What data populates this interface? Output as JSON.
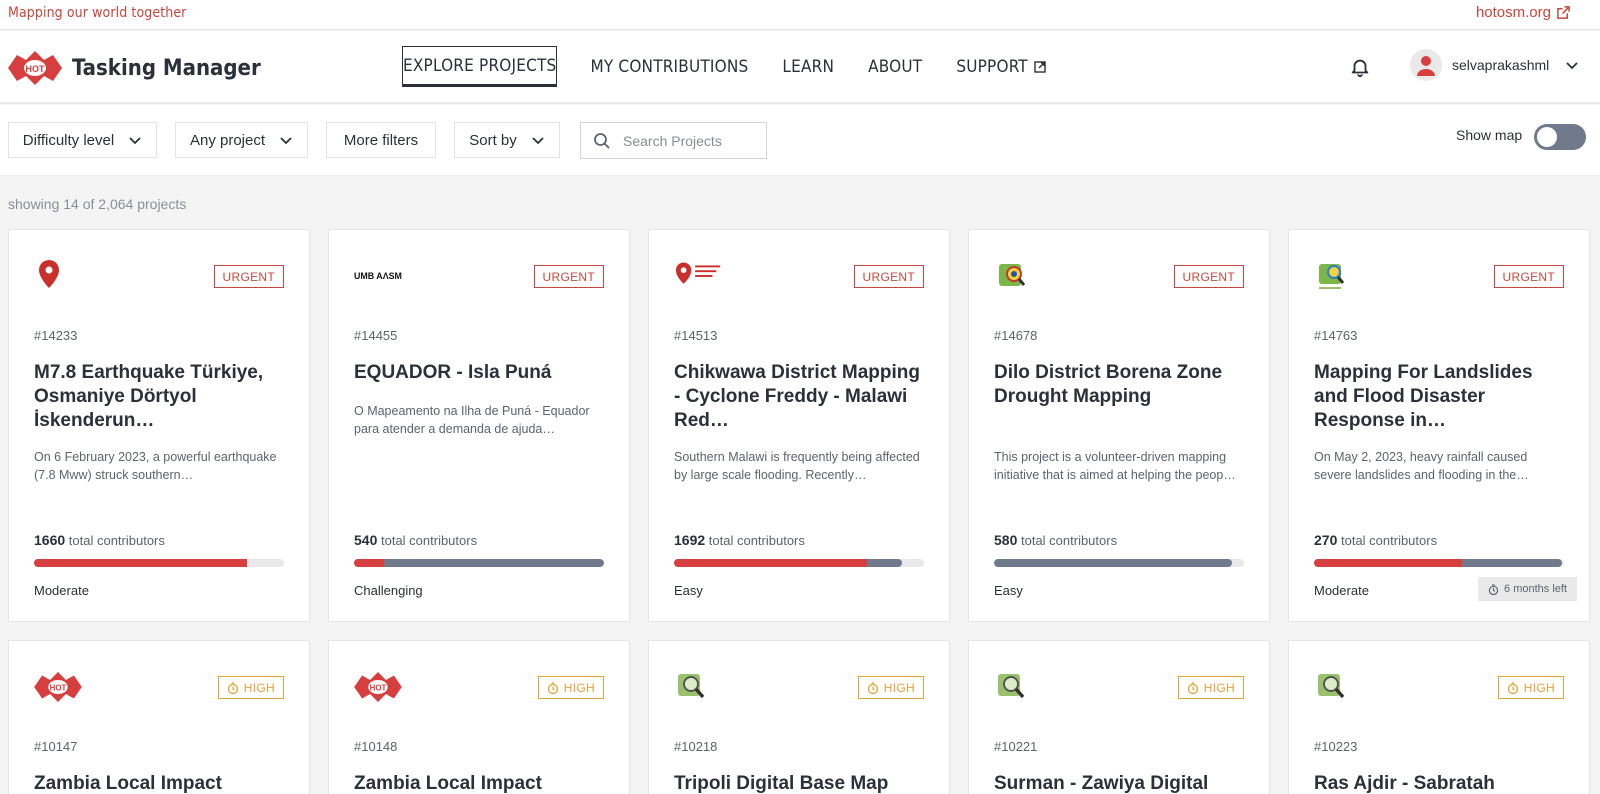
{
  "top": {
    "tagline": "Mapping our world together",
    "hot_link": "hotosm.org"
  },
  "nav": {
    "brand": "Tasking Manager",
    "logo_text": "HOT",
    "items": [
      {
        "label": "EXPLORE PROJECTS",
        "active": true
      },
      {
        "label": "MY CONTRIBUTIONS"
      },
      {
        "label": "LEARN"
      },
      {
        "label": "ABOUT"
      },
      {
        "label": "SUPPORT",
        "icon": "external-link-icon"
      }
    ],
    "username": "selvaprakashml"
  },
  "filters": {
    "difficulty": "Difficulty level",
    "project": "Any project",
    "more": "More filters",
    "sort": "Sort by",
    "search_placeholder": "Search Projects",
    "show_map": "Show map",
    "show_map_on": false
  },
  "count_text": "showing 14 of 2,064 projects",
  "labels": {
    "total_contributors": "total contributors"
  },
  "cards": [
    {
      "id": "#14233",
      "badge": "URGENT",
      "badge_type": "urgent",
      "title": "M7.8 Earthquake Türkiye, Osmaniye Dörtyol İskenderun…",
      "desc": "On 6 February 2023, a powerful earthquake (7.8 Mww) struck southern…",
      "contributors": "1660",
      "mapped": 0.85,
      "validated": 0.85,
      "difficulty": "Moderate",
      "logo": "red-pin-logo"
    },
    {
      "id": "#14455",
      "badge": "URGENT",
      "badge_type": "urgent",
      "title": "EQUADOR - Isla Puná",
      "desc": "O Mapeamento na Ilha de Puná - Equador para atender a demanda de ajuda…",
      "contributors": "540",
      "mapped": 0.12,
      "validated": 1.0,
      "difficulty": "Challenging",
      "logo": "umbrasm-logo",
      "logo_text": "UMB AΛSM"
    },
    {
      "id": "#14513",
      "badge": "URGENT",
      "badge_type": "urgent",
      "title": "Chikwawa District Mapping - Cyclone Freddy - Malawi Red…",
      "desc": "Southern Malawi is frequently being affected by large scale flooding. Recently…",
      "contributors": "1692",
      "mapped": 0.77,
      "validated": 0.91,
      "difficulty": "Easy",
      "logo": "open-mapping-hub-logo",
      "logo_text": "Open Mapping Hub"
    },
    {
      "id": "#14678",
      "badge": "URGENT",
      "badge_type": "urgent",
      "title": "Dilo District Borena Zone Drought Mapping",
      "desc": "This project is a volunteer-driven mapping initiative that is aimed at helping the peop…",
      "contributors": "580",
      "mapped": 0.0,
      "validated": 0.95,
      "difficulty": "Easy",
      "logo": "ethiopia-osm-logo"
    },
    {
      "id": "#14763",
      "badge": "URGENT",
      "badge_type": "urgent",
      "title": "Mapping For Landslides and Flood Disaster Response in…",
      "desc": "On May 2, 2023, heavy rainfall caused severe landslides and flooding in the…",
      "contributors": "270",
      "mapped": 0.59,
      "validated": 0.99,
      "difficulty": "Moderate",
      "logo": "rwanda-osm-logo",
      "time_left": "6 months left"
    },
    {
      "id": "#10147",
      "badge": "HIGH",
      "badge_type": "high",
      "title": "Zambia Local Impact",
      "logo": "hot-logo"
    },
    {
      "id": "#10148",
      "badge": "HIGH",
      "badge_type": "high",
      "title": "Zambia Local Impact",
      "logo": "hot-logo"
    },
    {
      "id": "#10218",
      "badge": "HIGH",
      "badge_type": "high",
      "title": "Tripoli Digital Base Map",
      "logo": "osm-magnifier-logo"
    },
    {
      "id": "#10221",
      "badge": "HIGH",
      "badge_type": "high",
      "title": "Surman - Zawiya Digital",
      "logo": "osm-magnifier-logo"
    },
    {
      "id": "#10223",
      "badge": "HIGH",
      "badge_type": "high",
      "title": "Ras Ajdir - Sabratah",
      "logo": "osm-magnifier-logo"
    }
  ]
}
